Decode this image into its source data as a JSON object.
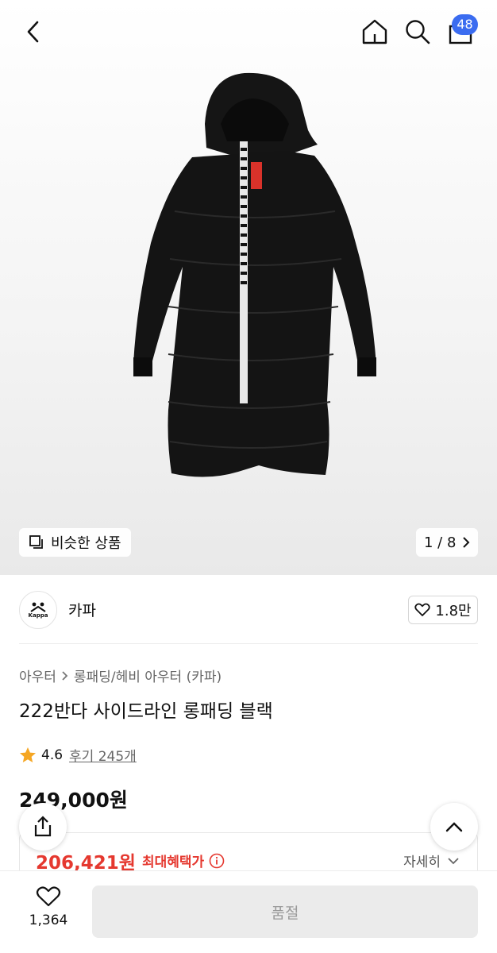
{
  "header": {
    "back_icon": "chevron-left-icon",
    "home_icon": "home-icon",
    "search_icon": "search-icon",
    "cart_icon": "shopping-bag-icon",
    "cart_count": "48",
    "badge_color": "#3b6cf0"
  },
  "hero": {
    "similar_label": "비슷한 상품",
    "pager": "1 / 8"
  },
  "brand": {
    "name": "카파",
    "logo_text": "Kappa",
    "likes": "1.8만"
  },
  "breadcrumb": {
    "level1": "아우터",
    "level2": "롱패딩/헤비 아우터 (카파)"
  },
  "product": {
    "title": "222반다 사이드라인 롱패딩 블랙",
    "rating": "4.6",
    "review_label": "후기 245개",
    "price": "249,000원",
    "benefit_price": "206,421원",
    "benefit_label": "최대혜택가",
    "detail_label": "자세히",
    "accent_color": "#e5382f"
  },
  "bottom": {
    "wish_count": "1,364",
    "buy_label": "품절"
  }
}
